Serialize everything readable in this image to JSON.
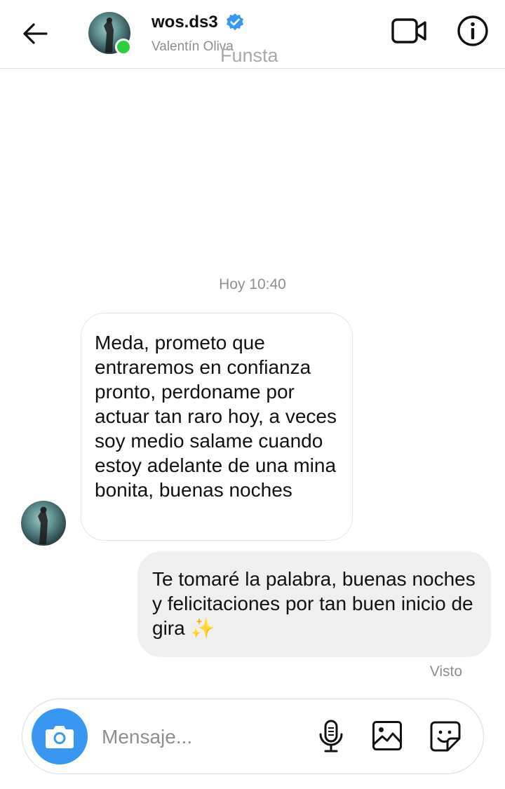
{
  "header": {
    "username": "wos.ds3",
    "full_name": "Valentín Oliva",
    "watermark": "Funsta",
    "icons": {
      "back": "arrow-left-icon",
      "verified": "verified-badge-icon",
      "video": "video-call-icon",
      "info": "info-icon"
    },
    "online_status_color": "#2ecc40",
    "verified_color": "#3897f0"
  },
  "thread": {
    "timestamp": "Hoy 10:40",
    "messages": [
      {
        "direction": "incoming",
        "text": "Meda, prometo que entraremos en confianza pronto, perdoname por actuar tan raro hoy, a veces soy medio salame cuando estoy adelante de una mina bonita, buenas noches"
      },
      {
        "direction": "outgoing",
        "text": "Te tomaré la palabra, buenas noches y felicitaciones por tan buen inicio de gira ✨"
      }
    ],
    "seen_label": "Visto"
  },
  "composer": {
    "placeholder": "Mensaje...",
    "value": "",
    "icons": {
      "camera": "camera-icon",
      "mic": "microphone-icon",
      "gallery": "image-gallery-icon",
      "sticker": "sticker-icon"
    },
    "camera_color": "#3897f0"
  }
}
